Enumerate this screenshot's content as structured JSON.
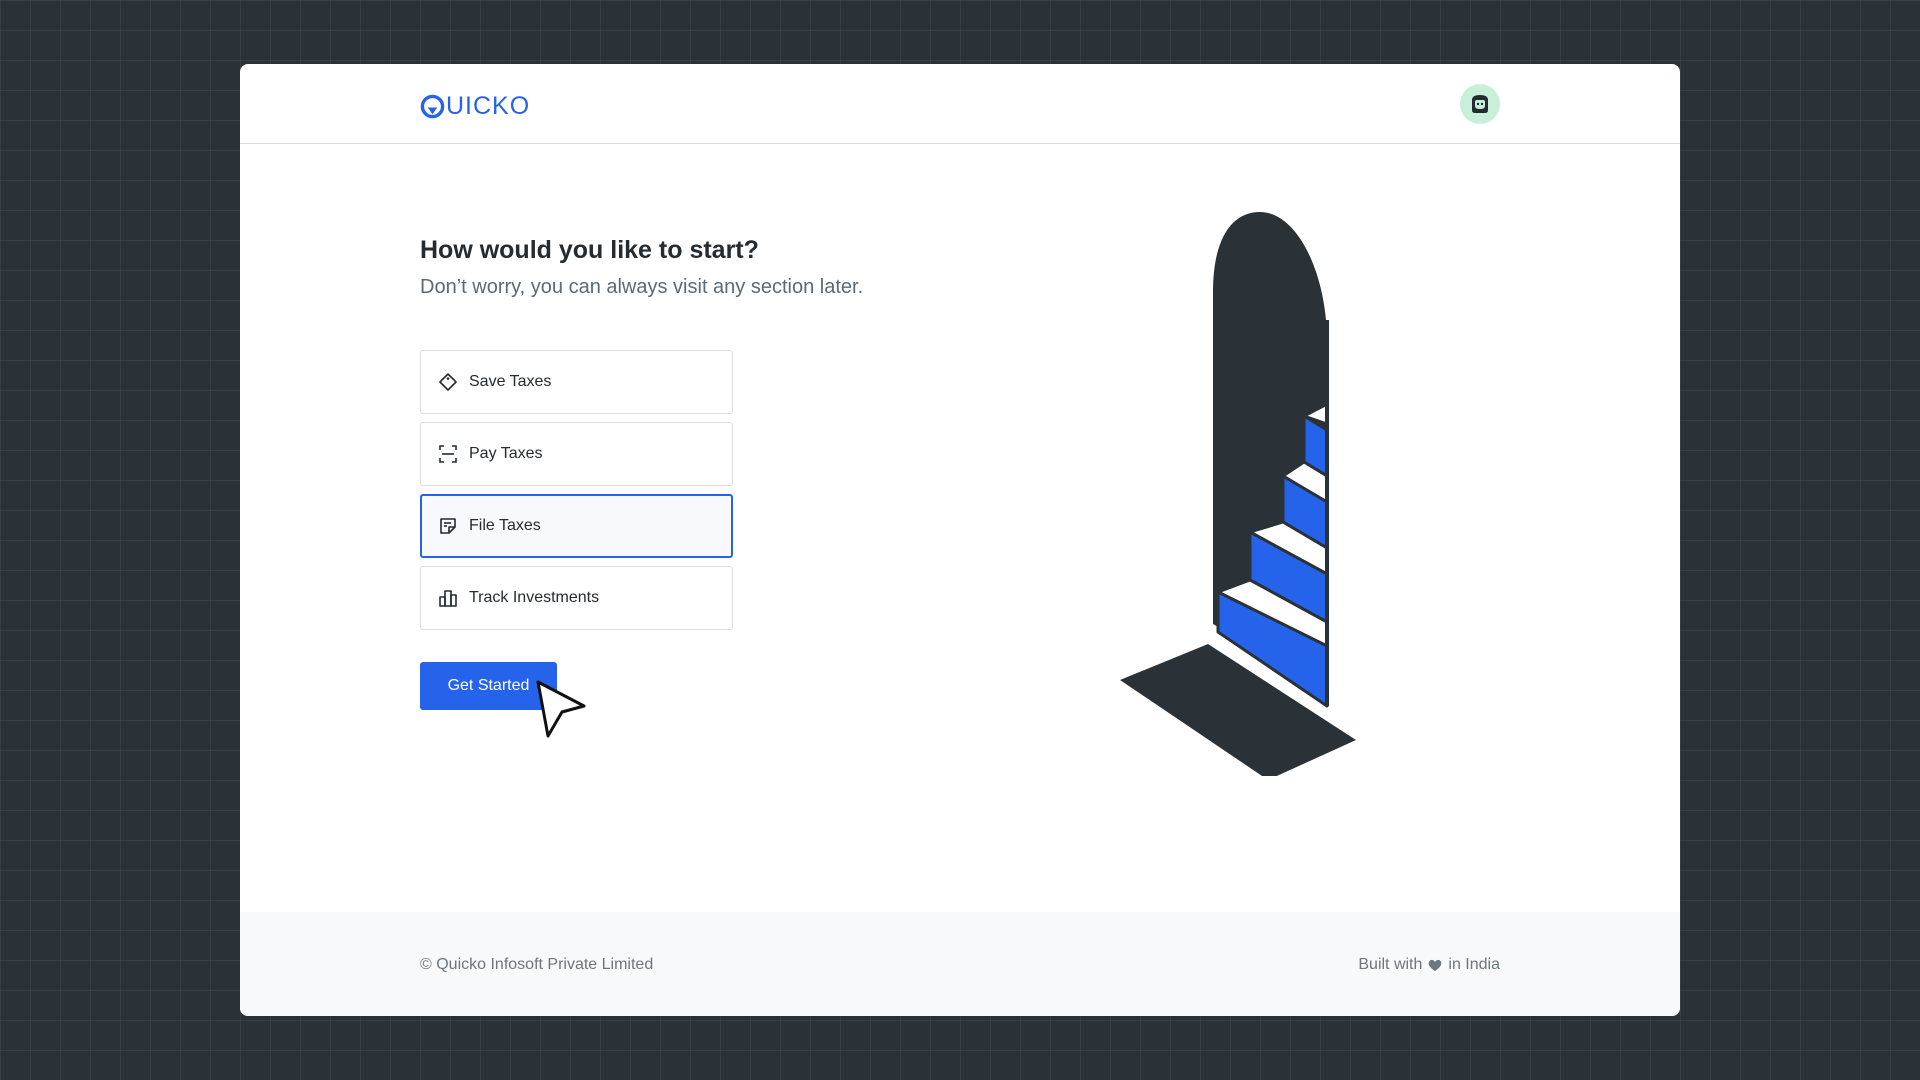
{
  "brand": {
    "name": "UICKO",
    "accent": "#2563eb"
  },
  "header": {
    "avatar_icon": "bot-avatar-icon"
  },
  "onboarding": {
    "heading": "How would you like to start?",
    "subheading": "Don’t worry, you can always visit any section later.",
    "options": [
      {
        "label": "Save Taxes",
        "icon": "tag-icon",
        "selected": false
      },
      {
        "label": "Pay Taxes",
        "icon": "scan-icon",
        "selected": false
      },
      {
        "label": "File Taxes",
        "icon": "sticky-note-icon",
        "selected": true
      },
      {
        "label": "Track Investments",
        "icon": "bar-chart-icon",
        "selected": false
      }
    ],
    "cta_label": "Get Started"
  },
  "footer": {
    "copyright": "© Quicko Infosoft Private Limited",
    "built_prefix": "Built with",
    "built_suffix": "in India"
  }
}
